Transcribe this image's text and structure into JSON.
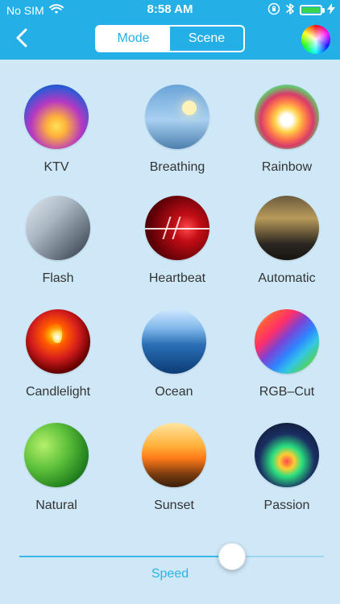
{
  "status_bar": {
    "carrier": "No SIM",
    "time": "8:58 AM"
  },
  "nav": {
    "tabs": [
      {
        "label": "Mode",
        "active": true
      },
      {
        "label": "Scene",
        "active": false
      }
    ],
    "accent_color": "#24b0e6",
    "icons": {
      "back": "chevron-left-icon",
      "color_picker": "color-wheel-icon"
    }
  },
  "modes": [
    {
      "label": "KTV"
    },
    {
      "label": "Breathing"
    },
    {
      "label": "Rainbow"
    },
    {
      "label": "Flash"
    },
    {
      "label": "Heartbeat"
    },
    {
      "label": "Automatic"
    },
    {
      "label": "Candlelight"
    },
    {
      "label": "Ocean"
    },
    {
      "label": "RGB–Cut"
    },
    {
      "label": "Natural"
    },
    {
      "label": "Sunset"
    },
    {
      "label": "Passion"
    }
  ],
  "speed": {
    "label": "Speed",
    "value_fraction": 0.7
  }
}
